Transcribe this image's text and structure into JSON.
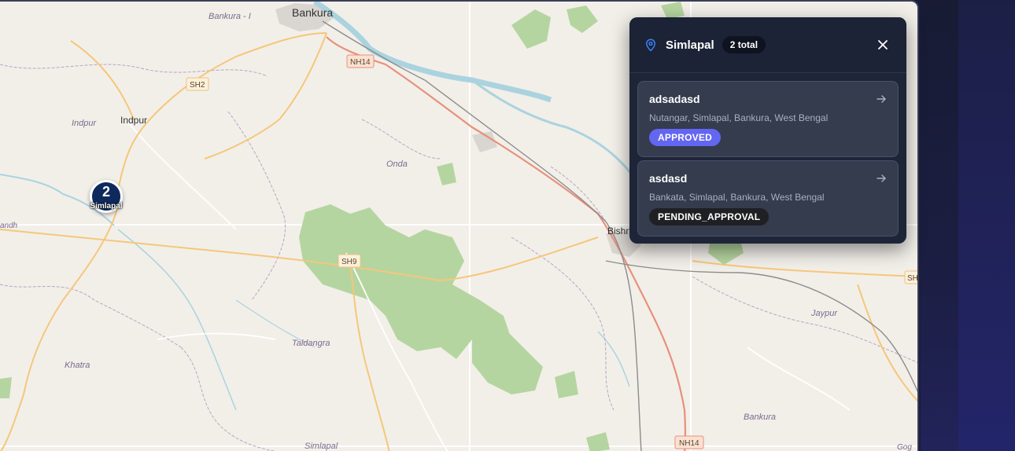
{
  "map": {
    "places": {
      "bankura_top": "Bankura",
      "bankura_i": "Bankura - I",
      "indpur": "Indpur",
      "indpur_area": "Indpur",
      "onda": "Onda",
      "simlapal_bottom": "Simlapal",
      "taldangra": "Taldangra",
      "khatra": "Khatra",
      "jaypur": "Jaypur",
      "bishnupur": "Bishn",
      "bankura_lower": "Bankura",
      "ranibandh": "andh",
      "google": "Gog"
    },
    "roads": {
      "nh14_top": "NH14",
      "sh2": "SH2",
      "sh9": "SH9",
      "nh14_bottom": "NH14",
      "sh_right": "SH"
    },
    "colors": {
      "land": "#f2efe9",
      "forest": "#b5d5a0",
      "water": "#aad3df",
      "highway": "#e8907a",
      "state_road": "#f5c77a"
    }
  },
  "cluster": {
    "count": "2",
    "name": "Simlapal"
  },
  "panel": {
    "icon": "map-pin-icon",
    "title": "Simlapal",
    "total_badge": "2 total",
    "close_icon": "close-icon",
    "items": [
      {
        "name": "adsadasd",
        "address": "Nutangar, Simlapal, Bankura, West Bengal",
        "status": "APPROVED",
        "status_color": "#6366f1"
      },
      {
        "name": "asdasd",
        "address": "Bankata, Simlapal, Bankura, West Bengal",
        "status": "PENDING_APPROVAL",
        "status_color": "#1f2023"
      }
    ]
  }
}
